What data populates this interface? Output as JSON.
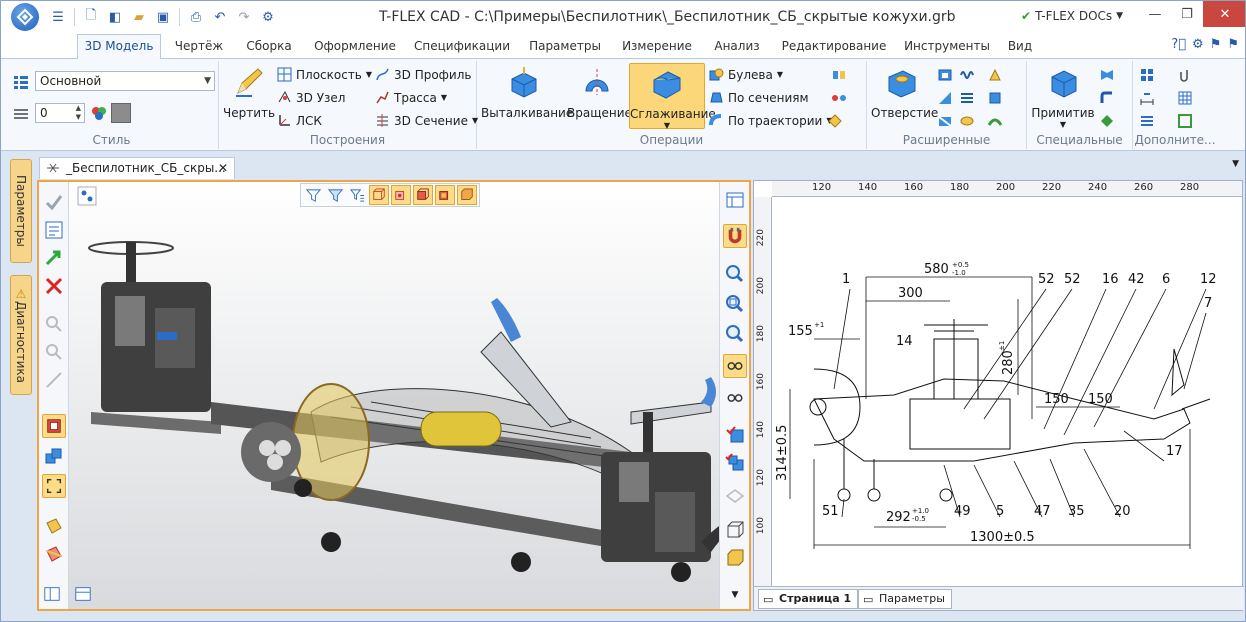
{
  "window": {
    "title": "T-FLEX CAD - C:\\Примеры\\Беспилотник\\_Беспилотник_СБ_скрытые кожухи.grb",
    "docs_label": "T-FLEX DOCs",
    "minimize": "—",
    "maximize": "❐",
    "close": "✕"
  },
  "ribbon_tabs": [
    {
      "label": "3D Модель",
      "active": true
    },
    {
      "label": "Чертёж"
    },
    {
      "label": "Сборка"
    },
    {
      "label": "Оформление"
    },
    {
      "label": "Спецификации"
    },
    {
      "label": "Параметры"
    },
    {
      "label": "Измерение"
    },
    {
      "label": "Анализ"
    },
    {
      "label": "Редактирование"
    },
    {
      "label": "Инструменты"
    },
    {
      "label": "Вид"
    }
  ],
  "groups": {
    "style": {
      "label": "Стиль",
      "layer_value": "Основной",
      "level_value": "0"
    },
    "construct": {
      "label": "Построения",
      "draw": "Чертить",
      "plane": "Плоскость",
      "node": "3D Узел",
      "lcs": "ЛСК",
      "profile": "3D Профиль",
      "path": "Трасса",
      "section": "3D Сечение"
    },
    "operations": {
      "label": "Операции",
      "extrude": "Выталкивание",
      "rotate": "Вращение",
      "smooth": "Сглаживание",
      "boolean": "Булева",
      "by_sections": "По сечениям",
      "by_path": "По траектории"
    },
    "extended": {
      "label": "Расширенные",
      "hole": "Отверстие"
    },
    "special": {
      "label": "Специальные",
      "primitives": "Примитив"
    },
    "extra": {
      "label": "Дополните..."
    }
  },
  "side_tabs": {
    "params": "Параметры",
    "diag": "Диагностика"
  },
  "document_tab": "_Беспилотник_СБ_скры...",
  "ruler_h": [
    "120",
    "140",
    "160",
    "180",
    "200",
    "220",
    "240",
    "260",
    "280"
  ],
  "ruler_v": [
    "220",
    "200",
    "180",
    "160",
    "140",
    "120",
    "100"
  ],
  "drawing": {
    "dim_580": "580",
    "dim_580_tol_up": "+0.5",
    "dim_580_tol_dn": "-1.0",
    "dim_300": "300",
    "dim_155": "155",
    "dim_155_sup": "+1",
    "dim_280": "280",
    "dim_280_sup": "±1",
    "dim_150a": "150",
    "dim_150b": "150",
    "dim_314": "314±0.5",
    "dim_292": "292",
    "dim_292_tol_up": "+1.0",
    "dim_292_tol_dn": "-0.5",
    "dim_1300": "1300±0.5",
    "callouts_top": [
      "1",
      "52",
      "52",
      "16",
      "42",
      "6",
      "12"
    ],
    "callout_7": "7",
    "callout_14": "14",
    "callout_17": "17",
    "callouts_bottom": [
      "51",
      "49",
      "5",
      "47",
      "35",
      "20"
    ]
  },
  "page_tabs": {
    "page1": "Страница 1",
    "params": "Параметры"
  },
  "colors": {
    "accent": "#f0a448",
    "ribbon_bg": "#f5f8fc",
    "frame_bg": "#dce6f2"
  }
}
